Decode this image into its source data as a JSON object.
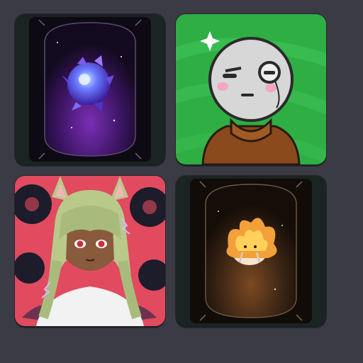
{
  "gallery": {
    "items": [
      {
        "subject": "purple-crystal-orb-card",
        "colors": {
          "bg": "#1a2422",
          "card": "#120a1e",
          "glow": "#6a2a9c",
          "gem": "#5a4fe6"
        }
      },
      {
        "subject": "monocle-character-avatar",
        "colors": {
          "bg": "#2fae44",
          "face": "#d7d7d7",
          "sweater": "#8a4a1c"
        }
      },
      {
        "subject": "fox-eared-anime-girl-avatar",
        "colors": {
          "bg": "#e24a5f",
          "hair": "#b8c98a",
          "skin": "#8a5a3c",
          "eyes": "#d22a3a"
        }
      },
      {
        "subject": "flame-spirit-creature-card",
        "colors": {
          "bg": "#1a2422",
          "card": "#1a120c",
          "glow": "#6a3a1a",
          "flame": "#f3a03a"
        }
      }
    ]
  }
}
